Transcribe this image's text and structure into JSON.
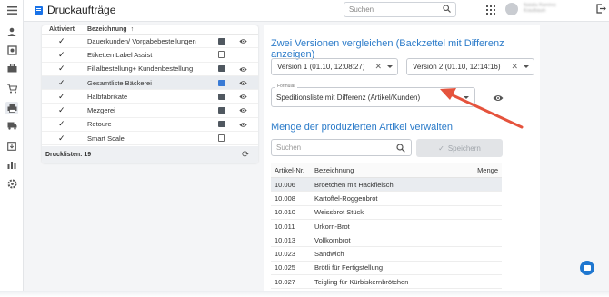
{
  "header": {
    "title": "Druckaufträge",
    "search_placeholder": "Suchen",
    "user_name": "Natalia Ramírez Krautbaum"
  },
  "rail": {
    "items": [
      "menu-icon",
      "user-icon",
      "settings-network-icon",
      "briefcase-icon",
      "cart-icon",
      "printer-icon",
      "truck-icon",
      "download-calendar-icon",
      "clipboard-icon",
      "stats-icon",
      "gear-icon"
    ]
  },
  "left_table": {
    "col_active": "Aktiviert",
    "col_name": "Bezeichnung",
    "sort_arrow": "↑",
    "rows": [
      {
        "name": "Dauerkunden/ Vorgabebestellungen",
        "checked": true,
        "type": "table",
        "highlight": false
      },
      {
        "name": "Etiketten Label Assist",
        "checked": true,
        "type": "doc",
        "highlight": false
      },
      {
        "name": "Filialbestellung+ Kundenbestellung",
        "checked": true,
        "type": "table",
        "highlight": false
      },
      {
        "name": "Gesamtliste Bäckerei",
        "checked": true,
        "type": "blue",
        "highlight": true
      },
      {
        "name": "Halbfabrikate",
        "checked": true,
        "type": "table",
        "highlight": false
      },
      {
        "name": "Mezgerei",
        "checked": true,
        "type": "table",
        "highlight": false
      },
      {
        "name": "Retoure",
        "checked": true,
        "type": "table",
        "highlight": false
      },
      {
        "name": "Smart Scale",
        "checked": true,
        "type": "doc",
        "highlight": false
      }
    ],
    "footer": "Drucklisten: 19"
  },
  "compare": {
    "heading": "Zwei Versionen vergleichen (Backzettel mit Differenz anzeigen)",
    "version1": "Version 1 (01.10, 12:08:27)",
    "version2": "Version 2 (01.10, 12:14:16)",
    "formular_label": "Formular",
    "formular_value": "Speditionsliste mit Differenz (Artikel/Kunden)"
  },
  "quantity": {
    "heading": "Menge der produzierten Artikel verwalten",
    "search_placeholder": "Suchen",
    "save_label": "Speichern",
    "col_nr": "Artikel-Nr.",
    "col_bez": "Bezeichnung",
    "col_menge": "Menge",
    "rows": [
      {
        "nr": "10.006",
        "bez": "Broetchen mit Hackfleisch",
        "menge": "",
        "highlight": true
      },
      {
        "nr": "10.008",
        "bez": "Kartoffel-Roggenbrot",
        "menge": "",
        "highlight": false
      },
      {
        "nr": "10.010",
        "bez": "Weissbrot Stück",
        "menge": "",
        "highlight": false
      },
      {
        "nr": "10.011",
        "bez": "Urkorn-Brot",
        "menge": "",
        "highlight": false
      },
      {
        "nr": "10.013",
        "bez": "Vollkornbrot",
        "menge": "",
        "highlight": false
      },
      {
        "nr": "10.023",
        "bez": "Sandwich",
        "menge": "",
        "highlight": false
      },
      {
        "nr": "10.025",
        "bez": "Brötli für Fertigstellung",
        "menge": "",
        "highlight": false
      },
      {
        "nr": "10.027",
        "bez": "Teigling für Kürbiskernbrötchen",
        "menge": "",
        "highlight": false
      }
    ]
  },
  "colors": {
    "accent": "#2b7bc9",
    "arrow": "#e5533d",
    "brand": "#1a73e8"
  }
}
